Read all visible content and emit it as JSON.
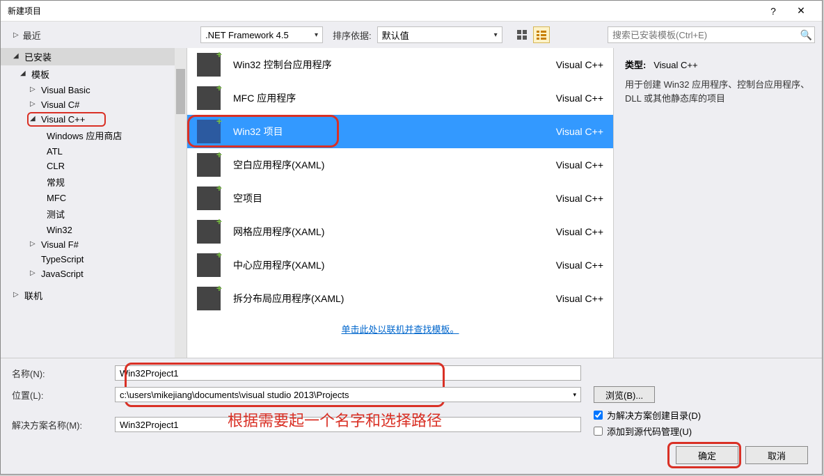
{
  "title": "新建项目",
  "titlebar": {
    "help": "?",
    "close": "✕"
  },
  "toolbar": {
    "framework": ".NET Framework 4.5",
    "sort_label": "排序依据:",
    "sort_value": "默认值",
    "search_placeholder": "搜索已安装模板(Ctrl+E)"
  },
  "tree": {
    "recent": "最近",
    "installed": "已安装",
    "templates": "模板",
    "vb": "Visual Basic",
    "csharp": "Visual C#",
    "vcpp": "Visual C++",
    "winstore": "Windows 应用商店",
    "atl": "ATL",
    "clr": "CLR",
    "changgui": "常规",
    "mfc": "MFC",
    "ceshi": "测试",
    "win32": "Win32",
    "fsharp": "Visual F#",
    "ts": "TypeScript",
    "js": "JavaScript",
    "online": "联机"
  },
  "templates": [
    {
      "name": "Win32 控制台应用程序",
      "lang": "Visual C++"
    },
    {
      "name": "MFC 应用程序",
      "lang": "Visual C++"
    },
    {
      "name": "Win32 项目",
      "lang": "Visual C++",
      "selected": true
    },
    {
      "name": "空白应用程序(XAML)",
      "lang": "Visual C++"
    },
    {
      "name": "空项目",
      "lang": "Visual C++"
    },
    {
      "name": "网格应用程序(XAML)",
      "lang": "Visual C++"
    },
    {
      "name": "中心应用程序(XAML)",
      "lang": "Visual C++"
    },
    {
      "name": "拆分布局应用程序(XAML)",
      "lang": "Visual C++"
    }
  ],
  "online_link": "单击此处以联机并查找模板。",
  "right": {
    "type_label": "类型:",
    "type_value": "Visual C++",
    "desc": "用于创建 Win32 应用程序、控制台应用程序、DLL 或其他静态库的项目"
  },
  "form": {
    "name_label": "名称(N):",
    "name_value": "Win32Project1",
    "loc_label": "位置(L):",
    "loc_value": "c:\\users\\mikejiang\\documents\\visual studio 2013\\Projects",
    "browse": "浏览(B)...",
    "sol_label": "解决方案名称(M):",
    "sol_value": "Win32Project1",
    "chk1": "为解决方案创建目录(D)",
    "chk2": "添加到源代码管理(U)",
    "annotation": "根据需要起一个名字和选择路径",
    "ok": "确定",
    "cancel": "取消"
  }
}
